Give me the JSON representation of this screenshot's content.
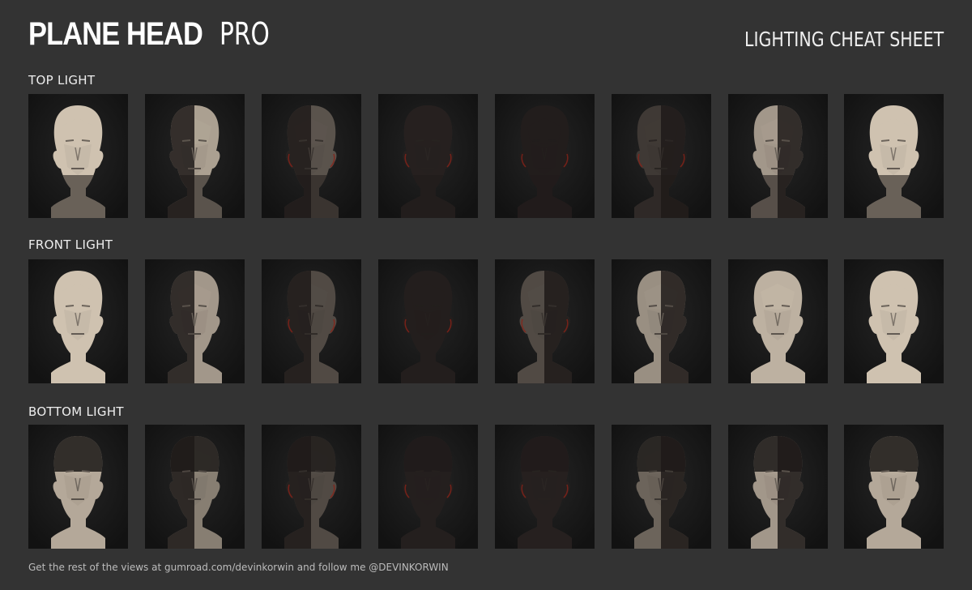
{
  "header": {
    "brand_bold": "PLANE HEAD",
    "brand_light": "PRO",
    "sheet_title": "LIGHTING CHEAT SHEET"
  },
  "rows": [
    {
      "label": "TOP LIGHT"
    },
    {
      "label": "FRONT LIGHT"
    },
    {
      "label": "BOTTOM LIGHT"
    }
  ],
  "footer": {
    "text": "Get the rest of the views at gumroad.com/devinkorwin and follow me @DEVINKORWIN"
  },
  "colors": {
    "page_background": "#333333",
    "tile_background": "#161616",
    "skin_lit": "#cfc2b0",
    "skin_shadow": "#1b1716",
    "rim_light": "#8a2218"
  }
}
